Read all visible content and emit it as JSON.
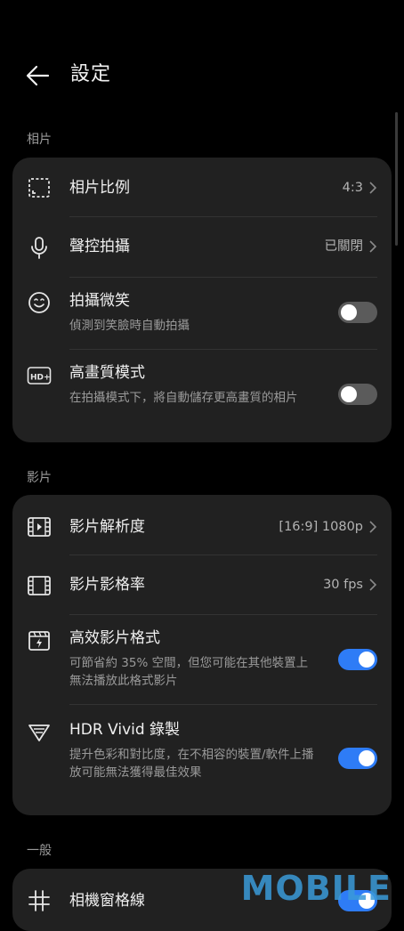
{
  "header": {
    "title": "設定"
  },
  "sections": {
    "photo": {
      "label": "相片",
      "ratio": {
        "title": "相片比例",
        "value": "4:3"
      },
      "voice": {
        "title": "聲控拍攝",
        "value": "已關閉"
      },
      "smile": {
        "title": "拍攝微笑",
        "subtitle": "偵測到笑臉時自動拍攝",
        "enabled": false
      },
      "hd": {
        "title": "高畫質模式",
        "subtitle": "在拍攝模式下，將自動儲存更高畫質的相片",
        "enabled": false
      }
    },
    "video": {
      "label": "影片",
      "resolution": {
        "title": "影片解析度",
        "value": "[16:9] 1080p"
      },
      "framerate": {
        "title": "影片影格率",
        "value": "30 fps"
      },
      "efficient": {
        "title": "高效影片格式",
        "subtitle": "可節省約 35% 空間，但您可能在其他裝置上無法播放此格式影片",
        "enabled": true
      },
      "hdr": {
        "title": "HDR Vivid 錄製",
        "subtitle": "提升色彩和對比度，在不相容的裝置/軟件上播放可能無法獲得最佳效果",
        "enabled": true
      }
    },
    "general": {
      "label": "一般",
      "grid": {
        "title": "相機窗格線",
        "enabled": true
      }
    }
  },
  "watermark": "MOBILE",
  "colors": {
    "accent": "#2e7cf6",
    "card": "#212121",
    "background": "#000000"
  }
}
